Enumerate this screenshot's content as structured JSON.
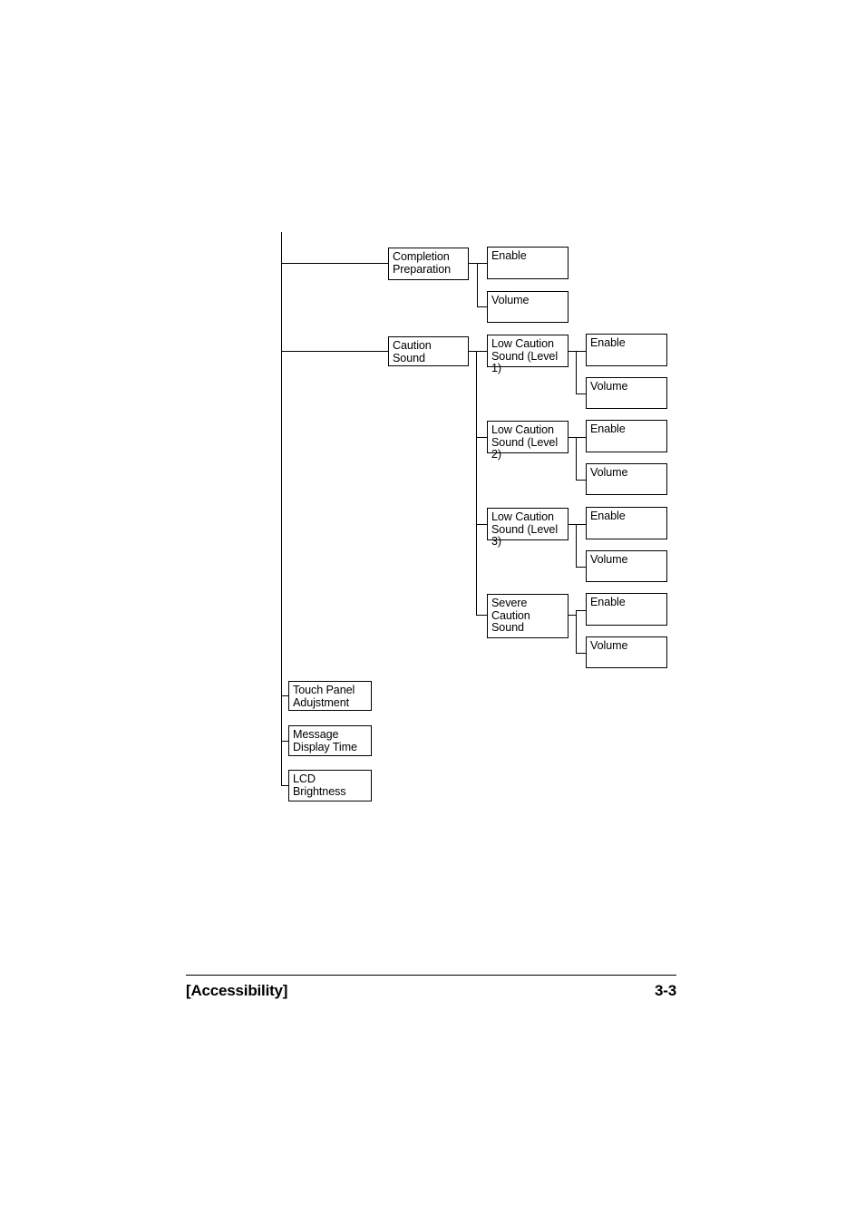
{
  "document": {
    "footer": {
      "section_label": "[Accessibility]",
      "page_number": "3-3"
    }
  },
  "diagram": {
    "type": "menu-tree",
    "description": "Accessibility setting menu tree",
    "trunk": {
      "label": ""
    },
    "nodes": {
      "completion_preparation": "Completion\nPreparation",
      "completion_preparation_enable": "Enable",
      "completion_preparation_volume": "Volume",
      "caution_sound": "Caution\nSound",
      "low_caution_level1": "Low Caution\nSound (Level 1)",
      "low_caution_level1_enable": "Enable",
      "low_caution_level1_volume": "Volume",
      "low_caution_level2": "Low Caution\nSound (Level 2)",
      "low_caution_level2_enable": "Enable",
      "low_caution_level2_volume": "Volume",
      "low_caution_level3": "Low Caution\nSound (Level 3)",
      "low_caution_level3_enable": "Enable",
      "low_caution_level3_volume": "Volume",
      "severe_caution_sound": "Severe\nCaution\nSound",
      "severe_caution_sound_enable": "Enable",
      "severe_caution_sound_volume": "Volume",
      "touch_panel_adjustment": "Touch Panel\nAdujstment",
      "message_display_time": " Message\nDisplay Time",
      "lcd_brightness": "LCD\nBrightness"
    }
  }
}
